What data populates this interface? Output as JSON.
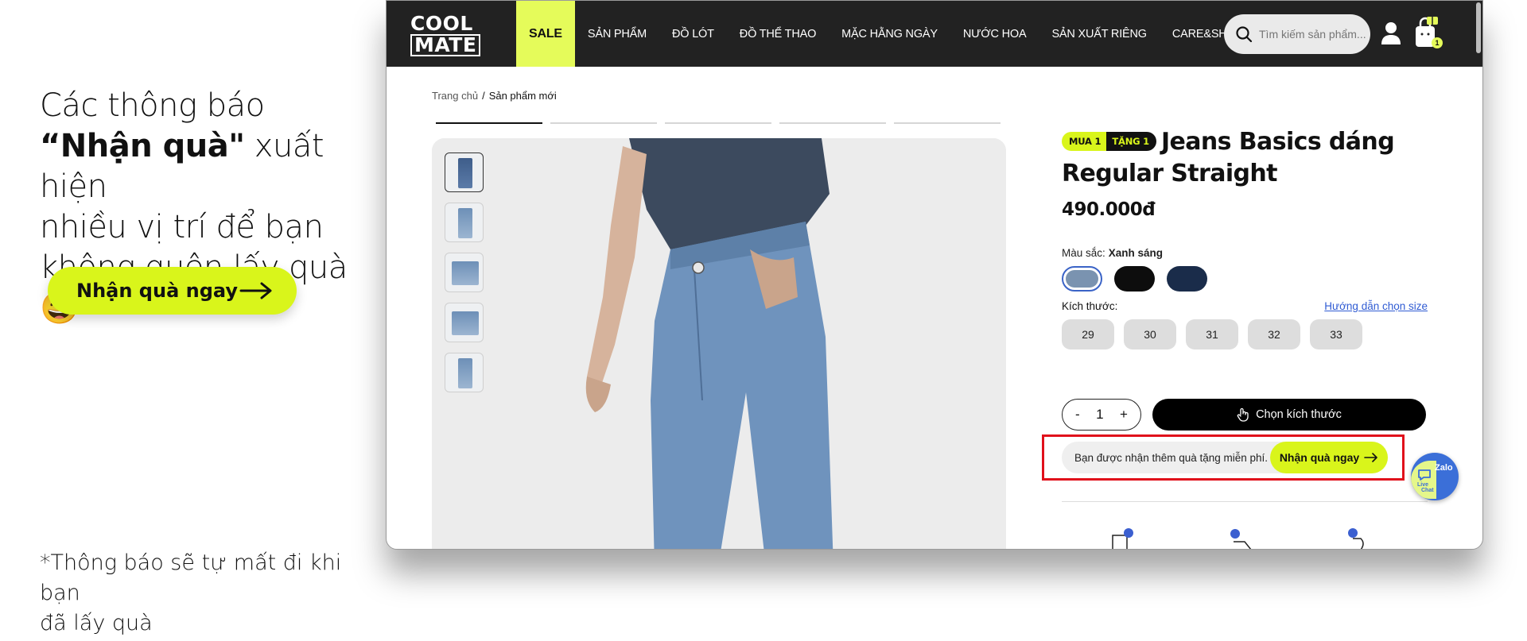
{
  "promo": {
    "line1": "Các thông báo",
    "bold": "“Nhận quà\"",
    "line2_rest": " xuất hiện",
    "line3": "nhiều vị trí để bạn",
    "line4": "không quên lấy quà 😄",
    "cta_label": "Nhận quà ngay",
    "note_line1": "*Thông báo sẽ tự mất đi khi bạn",
    "note_line2": "đã lấy quà"
  },
  "site": {
    "logo_top": "COOL",
    "logo_bottom": "MATE",
    "nav": [
      "SALE",
      "SẢN PHẨM",
      "ĐỒ LÓT",
      "ĐỒ THỂ THAO",
      "MẶC HẰNG NGÀY",
      "NƯỚC HOA",
      "SẢN XUẤT RIÊNG",
      "CARE&SHARE"
    ],
    "search_placeholder": "Tìm kiếm sản phẩm...",
    "cart_count": "1"
  },
  "breadcrumb": {
    "home": "Trang chủ",
    "sep": "/",
    "current": "Sản phẩm mới"
  },
  "product": {
    "badge_buy": "MUA 1",
    "badge_get": "TẶNG 1",
    "title": "Jeans Basics dáng Regular Straight",
    "price": "490.000đ",
    "color_label": "Màu sắc:",
    "color_value": "Xanh sáng",
    "swatch_colors": [
      "#7a93b0",
      "#0d0d0d",
      "#1a2c4a"
    ],
    "size_label": "Kích thước:",
    "size_guide": "Hướng dẫn chọn size",
    "sizes": [
      "29",
      "30",
      "31",
      "32",
      "33"
    ],
    "qty_minus": "-",
    "qty": "1",
    "qty_plus": "+",
    "choose_size": "Chọn kích thước",
    "gift_text": "Bạn được nhận thêm quà tặng miễn phí.",
    "gift_button": "Nhận quà ngay"
  },
  "chat": {
    "zalo": "Zalo",
    "live": "Live",
    "chat": "Chat"
  },
  "colors": {
    "accent": "#d9f51b",
    "nav_bg": "#222222",
    "highlight": "#e0101b",
    "link": "#2f5bd3"
  }
}
